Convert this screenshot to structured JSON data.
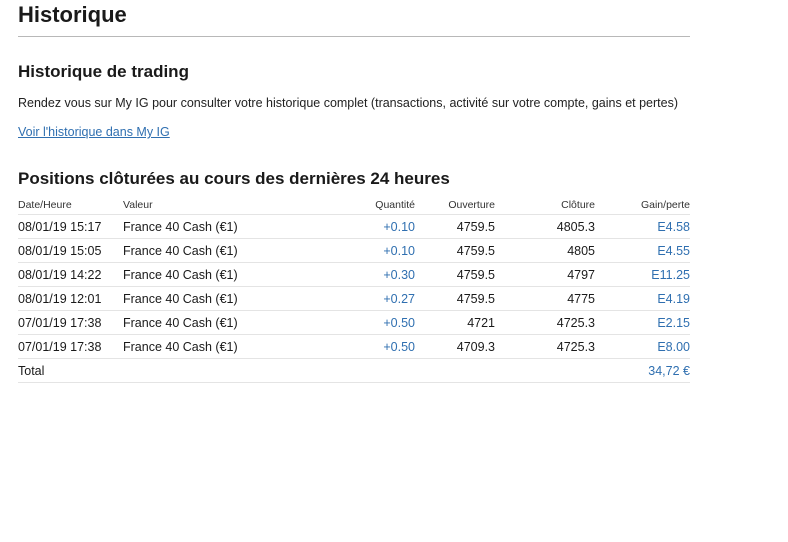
{
  "page": {
    "title": "Historique"
  },
  "trading_history": {
    "title": "Historique de trading",
    "description": "Rendez vous sur My IG pour consulter votre historique complet (transactions, activité sur votre compte, gains et pertes)",
    "link_label": "Voir l'historique dans My IG"
  },
  "closed_positions": {
    "title": "Positions clôturées au cours des dernières 24 heures",
    "columns": {
      "date": "Date/Heure",
      "value": "Valeur",
      "quantity": "Quantité",
      "open": "Ouverture",
      "close": "Clôture",
      "gain": "Gain/perte"
    },
    "rows": [
      {
        "date": "08/01/19 15:17",
        "value": "France 40 Cash (€1)",
        "quantity": "+0.10",
        "open": "4759.5",
        "close": "4805.3",
        "gain": "E4.58"
      },
      {
        "date": "08/01/19 15:05",
        "value": "France 40 Cash (€1)",
        "quantity": "+0.10",
        "open": "4759.5",
        "close": "4805",
        "gain": "E4.55"
      },
      {
        "date": "08/01/19 14:22",
        "value": "France 40 Cash (€1)",
        "quantity": "+0.30",
        "open": "4759.5",
        "close": "4797",
        "gain": "E11.25"
      },
      {
        "date": "08/01/19 12:01",
        "value": "France 40 Cash (€1)",
        "quantity": "+0.27",
        "open": "4759.5",
        "close": "4775",
        "gain": "E4.19"
      },
      {
        "date": "07/01/19 17:38",
        "value": "France 40 Cash (€1)",
        "quantity": "+0.50",
        "open": "4721",
        "close": "4725.3",
        "gain": "E2.15"
      },
      {
        "date": "07/01/19 17:38",
        "value": "France 40 Cash (€1)",
        "quantity": "+0.50",
        "open": "4709.3",
        "close": "4725.3",
        "gain": "E8.00"
      }
    ],
    "total_label": "Total",
    "total_value": "34,72 €"
  }
}
